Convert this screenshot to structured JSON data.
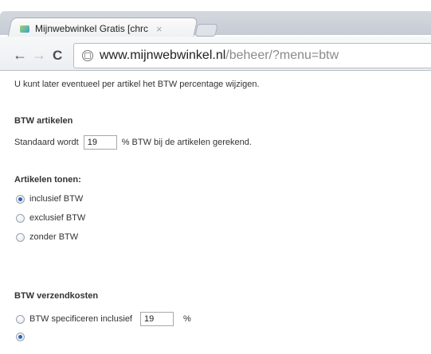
{
  "browser": {
    "tab_title": "Mijnwebwinkel Gratis [chrc",
    "tab_close": "×",
    "url_host": "www.mijnwebwinkel.nl",
    "url_path": "/beheer/?menu=btw",
    "back": "←",
    "forward": "→",
    "reload": "C"
  },
  "page": {
    "intro": "U kunt later eventueel per artikel het BTW percentage wijzigen.",
    "btw_artikelen": {
      "heading": "BTW artikelen",
      "prefix": "Standaard wordt",
      "value": "19",
      "suffix": "% BTW bij de artikelen gerekend."
    },
    "artikelen_tonen": {
      "heading": "Artikelen tonen:",
      "options": [
        {
          "label": "inclusief BTW",
          "checked": true
        },
        {
          "label": "exclusief BTW",
          "checked": false
        },
        {
          "label": "zonder BTW",
          "checked": false
        }
      ]
    },
    "verzendkosten": {
      "heading": "BTW verzendkosten",
      "option1_prefix": "BTW specificeren inclusief",
      "option1_value": "19",
      "option1_suffix": "%"
    }
  },
  "colors": {
    "radio_selected": "#2a63b8",
    "url_path": "#8a8a8a"
  }
}
